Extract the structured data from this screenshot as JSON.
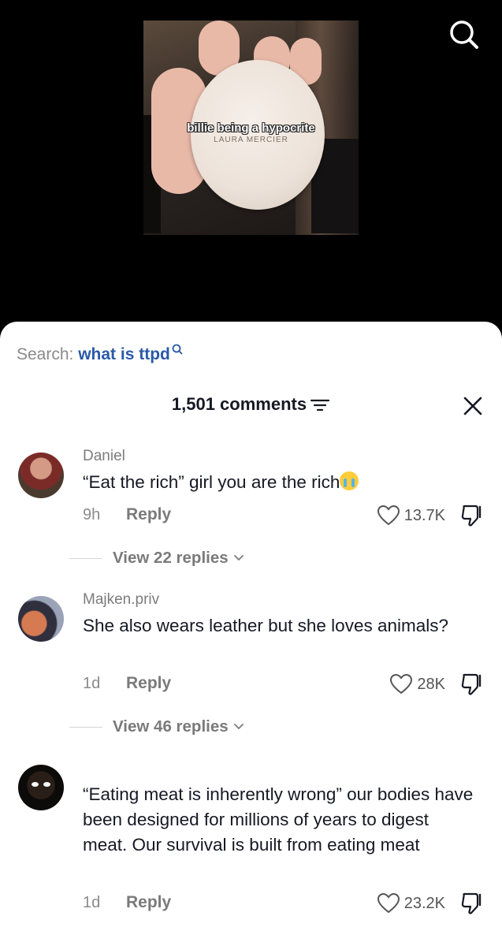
{
  "video": {
    "caption": "billie being a hypocrite",
    "brand_text": "LAURA MERCIER"
  },
  "search": {
    "prefix": "Search:",
    "term": "what is ttpd"
  },
  "header": {
    "count_label": "1,501 comments"
  },
  "comments": [
    {
      "username": "Daniel",
      "text": "“Eat the rich” girl you are the rich",
      "emoji": "crying-face",
      "time": "9h",
      "reply_label": "Reply",
      "likes": "13.7K",
      "view_replies": "View 22 replies"
    },
    {
      "username": "Majken.priv",
      "text": "She also wears leather but she loves animals?",
      "time": "1d",
      "reply_label": "Reply",
      "likes": "28K",
      "view_replies": "View 46 replies"
    },
    {
      "username": "",
      "text": "“Eating meat is inherently wrong” our bodies have been designed for millions of years to digest meat. Our survival is built from eating meat",
      "time": "1d",
      "reply_label": "Reply",
      "likes": "23.2K"
    }
  ],
  "icons": {
    "top_search": "search-icon",
    "filter": "filter-icon",
    "close": "close-icon",
    "like": "heart-icon",
    "dislike": "thumbs-down-icon",
    "chevron": "chevron-down-icon"
  },
  "colors": {
    "search_term": "#2a59a8",
    "text_primary": "#161823",
    "text_secondary": "#8a8a8a",
    "sheet_bg": "#ffffff",
    "video_bg": "#000000"
  }
}
